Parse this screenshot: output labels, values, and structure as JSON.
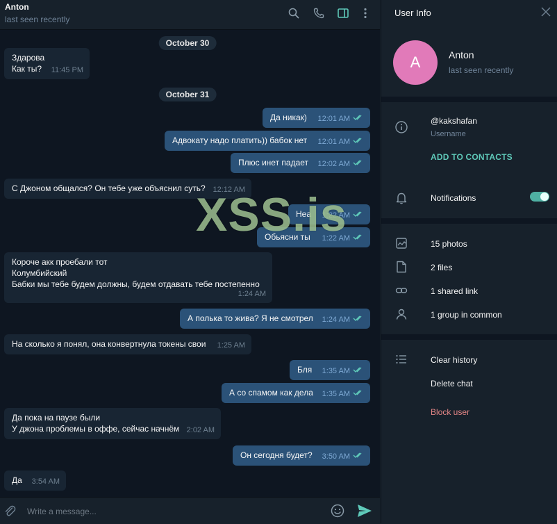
{
  "header": {
    "name": "Anton",
    "status": "last seen recently"
  },
  "dates": [
    "October 30",
    "October 31"
  ],
  "messages": [
    {
      "dir": "in",
      "text": "Здарова\nКак ты?",
      "time": "11:45 PM"
    },
    {
      "dir": "out",
      "text": "Да никак)",
      "time": "12:01 AM"
    },
    {
      "dir": "out",
      "text": "Адвокату надо платить)) бабок нет",
      "time": "12:01 AM"
    },
    {
      "dir": "out",
      "text": "Плюс инет падает",
      "time": "12:02 AM"
    },
    {
      "dir": "in",
      "text": "С Джоном общался? Он тебе уже объяснил суть?",
      "time": "12:12 AM"
    },
    {
      "dir": "out",
      "text": "Неа",
      "time": "1:22 AM"
    },
    {
      "dir": "out",
      "text": "Обьясни ты",
      "time": "1:22 AM"
    },
    {
      "dir": "in",
      "text": "Короче акк проебали тот\nКолумбийский\nБабки мы тебе будем должны, будем отдавать тебе постепенно",
      "time": "1:24 AM"
    },
    {
      "dir": "out",
      "text": "А полька то жива? Я не смотрел",
      "time": "1:24 AM"
    },
    {
      "dir": "in",
      "text": "На сколько я понял, она конвертнула токены свои",
      "time": "1:25 AM"
    },
    {
      "dir": "out",
      "text": "Бля",
      "time": "1:35 AM"
    },
    {
      "dir": "out",
      "text": "А со спамом как дела",
      "time": "1:35 AM"
    },
    {
      "dir": "in",
      "text": "Да пока на паузе были\nУ джона проблемы в оффе, сейчас начнём",
      "time": "2:02 AM"
    },
    {
      "dir": "out",
      "text": "Он сегодня будет?",
      "time": "3:50 AM"
    },
    {
      "dir": "in",
      "text": "Да",
      "time": "3:54 AM"
    }
  ],
  "composer": {
    "placeholder": "Write a message..."
  },
  "panel": {
    "title": "User Info",
    "avatar_letter": "A",
    "name": "Anton",
    "status": "last seen recently",
    "username": "@kakshafan",
    "username_label": "Username",
    "add_contact": "ADD TO CONTACTS",
    "notifications": "Notifications",
    "notifications_on": true,
    "media": {
      "photos": "15 photos",
      "files": "2 files",
      "links": "1 shared link",
      "groups": "1 group in common"
    },
    "actions": {
      "clear": "Clear history",
      "delete": "Delete chat",
      "block": "Block user"
    }
  },
  "watermark": "XSS.is",
  "colors": {
    "accent": "#5fc9b9",
    "outgoing_bubble": "#2b5278",
    "incoming_bubble": "#182533",
    "avatar": "#e17ab9",
    "danger": "#e48686"
  }
}
